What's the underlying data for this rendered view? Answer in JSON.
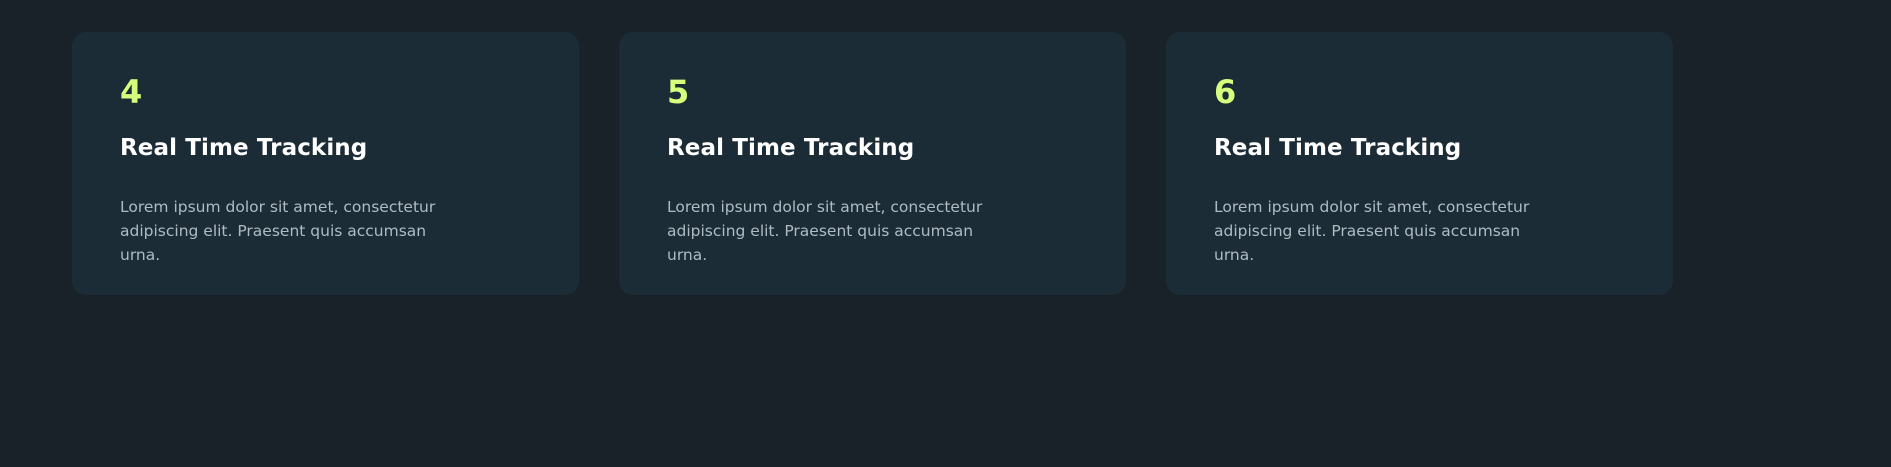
{
  "colors": {
    "page_background": "#182228",
    "card_background": "#1c2c36",
    "number_accent": "#d7ff7e",
    "title_text": "#ffffff",
    "description_text": "#aebbc3"
  },
  "cards": [
    {
      "number": "4",
      "title": "Real Time Tracking",
      "description": "Lorem ipsum dolor sit amet, consectetur adipiscing elit. Praesent quis accumsan urna."
    },
    {
      "number": "5",
      "title": "Real Time Tracking",
      "description": "Lorem ipsum dolor sit amet, consectetur adipiscing elit. Praesent quis accumsan urna."
    },
    {
      "number": "6",
      "title": "Real Time Tracking",
      "description": "Lorem ipsum dolor sit amet, consectetur adipiscing elit. Praesent quis accumsan urna."
    }
  ]
}
